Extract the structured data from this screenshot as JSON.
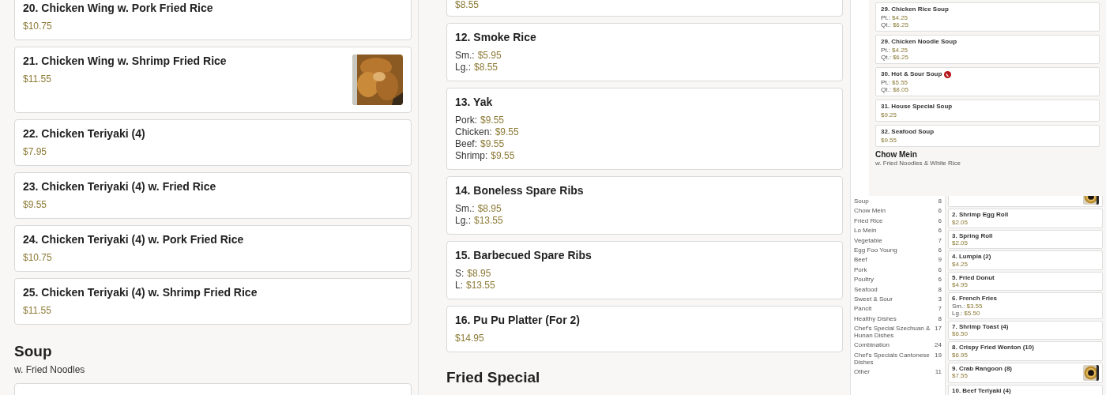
{
  "left_panel": {
    "items": [
      {
        "name": "20. Chicken Wing w. Pork Fried Rice",
        "prices": [
          {
            "value": "$10.75"
          }
        ],
        "picture": false
      },
      {
        "name": "21. Chicken Wing w. Shrimp Fried Rice",
        "prices": [
          {
            "value": "$11.55"
          }
        ],
        "picture": true
      },
      {
        "name": "22. Chicken Teriyaki (4)",
        "prices": [
          {
            "value": "$7.95"
          }
        ],
        "picture": false
      },
      {
        "name": "23. Chicken Teriyaki (4) w. Fried Rice",
        "prices": [
          {
            "value": "$9.55"
          }
        ],
        "picture": false
      },
      {
        "name": "24. Chicken Teriyaki (4) w. Pork Fried Rice",
        "prices": [
          {
            "value": "$10.75"
          }
        ],
        "picture": false
      },
      {
        "name": "25. Chicken Teriyaki (4) w. Shrimp Fried Rice",
        "prices": [
          {
            "value": "$11.55"
          }
        ],
        "picture": false
      }
    ],
    "section": {
      "title": "Soup",
      "subtitle": "w. Fried Noodles"
    }
  },
  "middle_panel": {
    "items": [
      {
        "prices": [
          {
            "value": "$8.55"
          }
        ],
        "picture": false
      },
      {
        "name": "12. Smoke Rice",
        "prices": [
          {
            "label": "Sm.:",
            "value": "$5.95"
          },
          {
            "label": "Lg.:",
            "value": "$8.55"
          }
        ],
        "picture": false
      },
      {
        "name": "13. Yak",
        "prices": [
          {
            "label": "Pork:",
            "value": "$9.55"
          },
          {
            "label": "Chicken:",
            "value": "$9.55"
          },
          {
            "label": "Beef:",
            "value": "$9.55"
          },
          {
            "label": "Shrimp:",
            "value": "$9.55"
          }
        ],
        "picture": false
      },
      {
        "name": "14. Boneless Spare Ribs",
        "prices": [
          {
            "label": "Sm.:",
            "value": "$8.95"
          },
          {
            "label": "Lg.:",
            "value": "$13.55"
          }
        ],
        "picture": false
      },
      {
        "name": "15. Barbecued Spare Ribs",
        "prices": [
          {
            "label": "S:",
            "value": "$8.95"
          },
          {
            "label": "L:",
            "value": "$13.55"
          }
        ],
        "picture": false
      },
      {
        "name": "16. Pu Pu Platter (For 2)",
        "prices": [
          {
            "value": "$14.95"
          }
        ],
        "picture": false
      }
    ],
    "section": {
      "title": "Fried Special"
    }
  },
  "preview": {
    "soup_items": [
      {
        "name": "29. Chicken Rice Soup",
        "prices": [
          {
            "label": "Pt.:",
            "value": "$4.25"
          },
          {
            "label": "Qt.:",
            "value": "$6.25"
          }
        ],
        "spicy": false
      },
      {
        "name": "29. Chicken Noodle Soup",
        "prices": [
          {
            "label": "Pt.:",
            "value": "$4.25"
          },
          {
            "label": "Qt.:",
            "value": "$6.25"
          }
        ],
        "spicy": false
      },
      {
        "name": "30. Hot & Sour Soup",
        "prices": [
          {
            "label": "Pt.:",
            "value": "$5.55"
          },
          {
            "label": "Qt.:",
            "value": "$8.05"
          }
        ],
        "spicy": true
      },
      {
        "name": "31. House Special Soup",
        "prices": [
          {
            "value": "$9.25"
          }
        ],
        "spicy": false
      },
      {
        "name": "32. Seafood Soup",
        "prices": [
          {
            "value": "$9.55"
          }
        ],
        "spicy": false
      }
    ],
    "section": {
      "title": "Chow Mein",
      "subtitle": "w. Fried Noodles & White Rice"
    },
    "categories": [
      {
        "name": "Soup",
        "count": "8"
      },
      {
        "name": "Chow Mein",
        "count": "6"
      },
      {
        "name": "Fried Rice",
        "count": "6"
      },
      {
        "name": "Lo Mein",
        "count": "6"
      },
      {
        "name": "Vegetable",
        "count": "7"
      },
      {
        "name": "Egg Foo Young",
        "count": "6"
      },
      {
        "name": "Beef",
        "count": "9"
      },
      {
        "name": "Pork",
        "count": "6"
      },
      {
        "name": "Poultry",
        "count": "6"
      },
      {
        "name": "Seafood",
        "count": "8"
      },
      {
        "name": "Sweet & Sour",
        "count": "3"
      },
      {
        "name": "Pancit",
        "count": "7"
      },
      {
        "name": "Healthy Dishes",
        "count": "8"
      },
      {
        "name": "Chef's Special Szechuan & Hunan Dishes",
        "count": "17"
      },
      {
        "name": "Combination",
        "count": "24"
      },
      {
        "name": "Chef's Specials Cantonese Dishes",
        "count": "19"
      },
      {
        "name": "Other",
        "count": "11"
      }
    ],
    "appetizer_items": [
      {
        "picture": true
      },
      {
        "name": "2. Shrimp Egg Roll",
        "prices": [
          {
            "value": "$2.05"
          }
        ],
        "picture": false
      },
      {
        "name": "3. Spring Roll",
        "prices": [
          {
            "value": "$2.05"
          }
        ],
        "picture": false
      },
      {
        "name": "4. Lumpia (2)",
        "prices": [
          {
            "value": "$4.25"
          }
        ],
        "picture": false
      },
      {
        "name": "5. Fried Donut",
        "prices": [
          {
            "value": "$4.95"
          }
        ],
        "picture": false
      },
      {
        "name": "6. French Fries",
        "prices": [
          {
            "label": "Sm.:",
            "value": "$3.55"
          },
          {
            "label": "Lg.:",
            "value": "$5.50"
          }
        ],
        "picture": false
      },
      {
        "name": "7. Shrimp Toast (4)",
        "prices": [
          {
            "value": "$6.50"
          }
        ],
        "picture": false
      },
      {
        "name": "8. Crispy Fried Wonton (10)",
        "prices": [
          {
            "value": "$6.95"
          }
        ],
        "picture": false
      },
      {
        "name": "9. Crab Rangoon (8)",
        "prices": [
          {
            "value": "$7.55"
          }
        ],
        "picture": true
      },
      {
        "name": "10. Beef Teriyaki (4)",
        "picture": false
      }
    ]
  }
}
